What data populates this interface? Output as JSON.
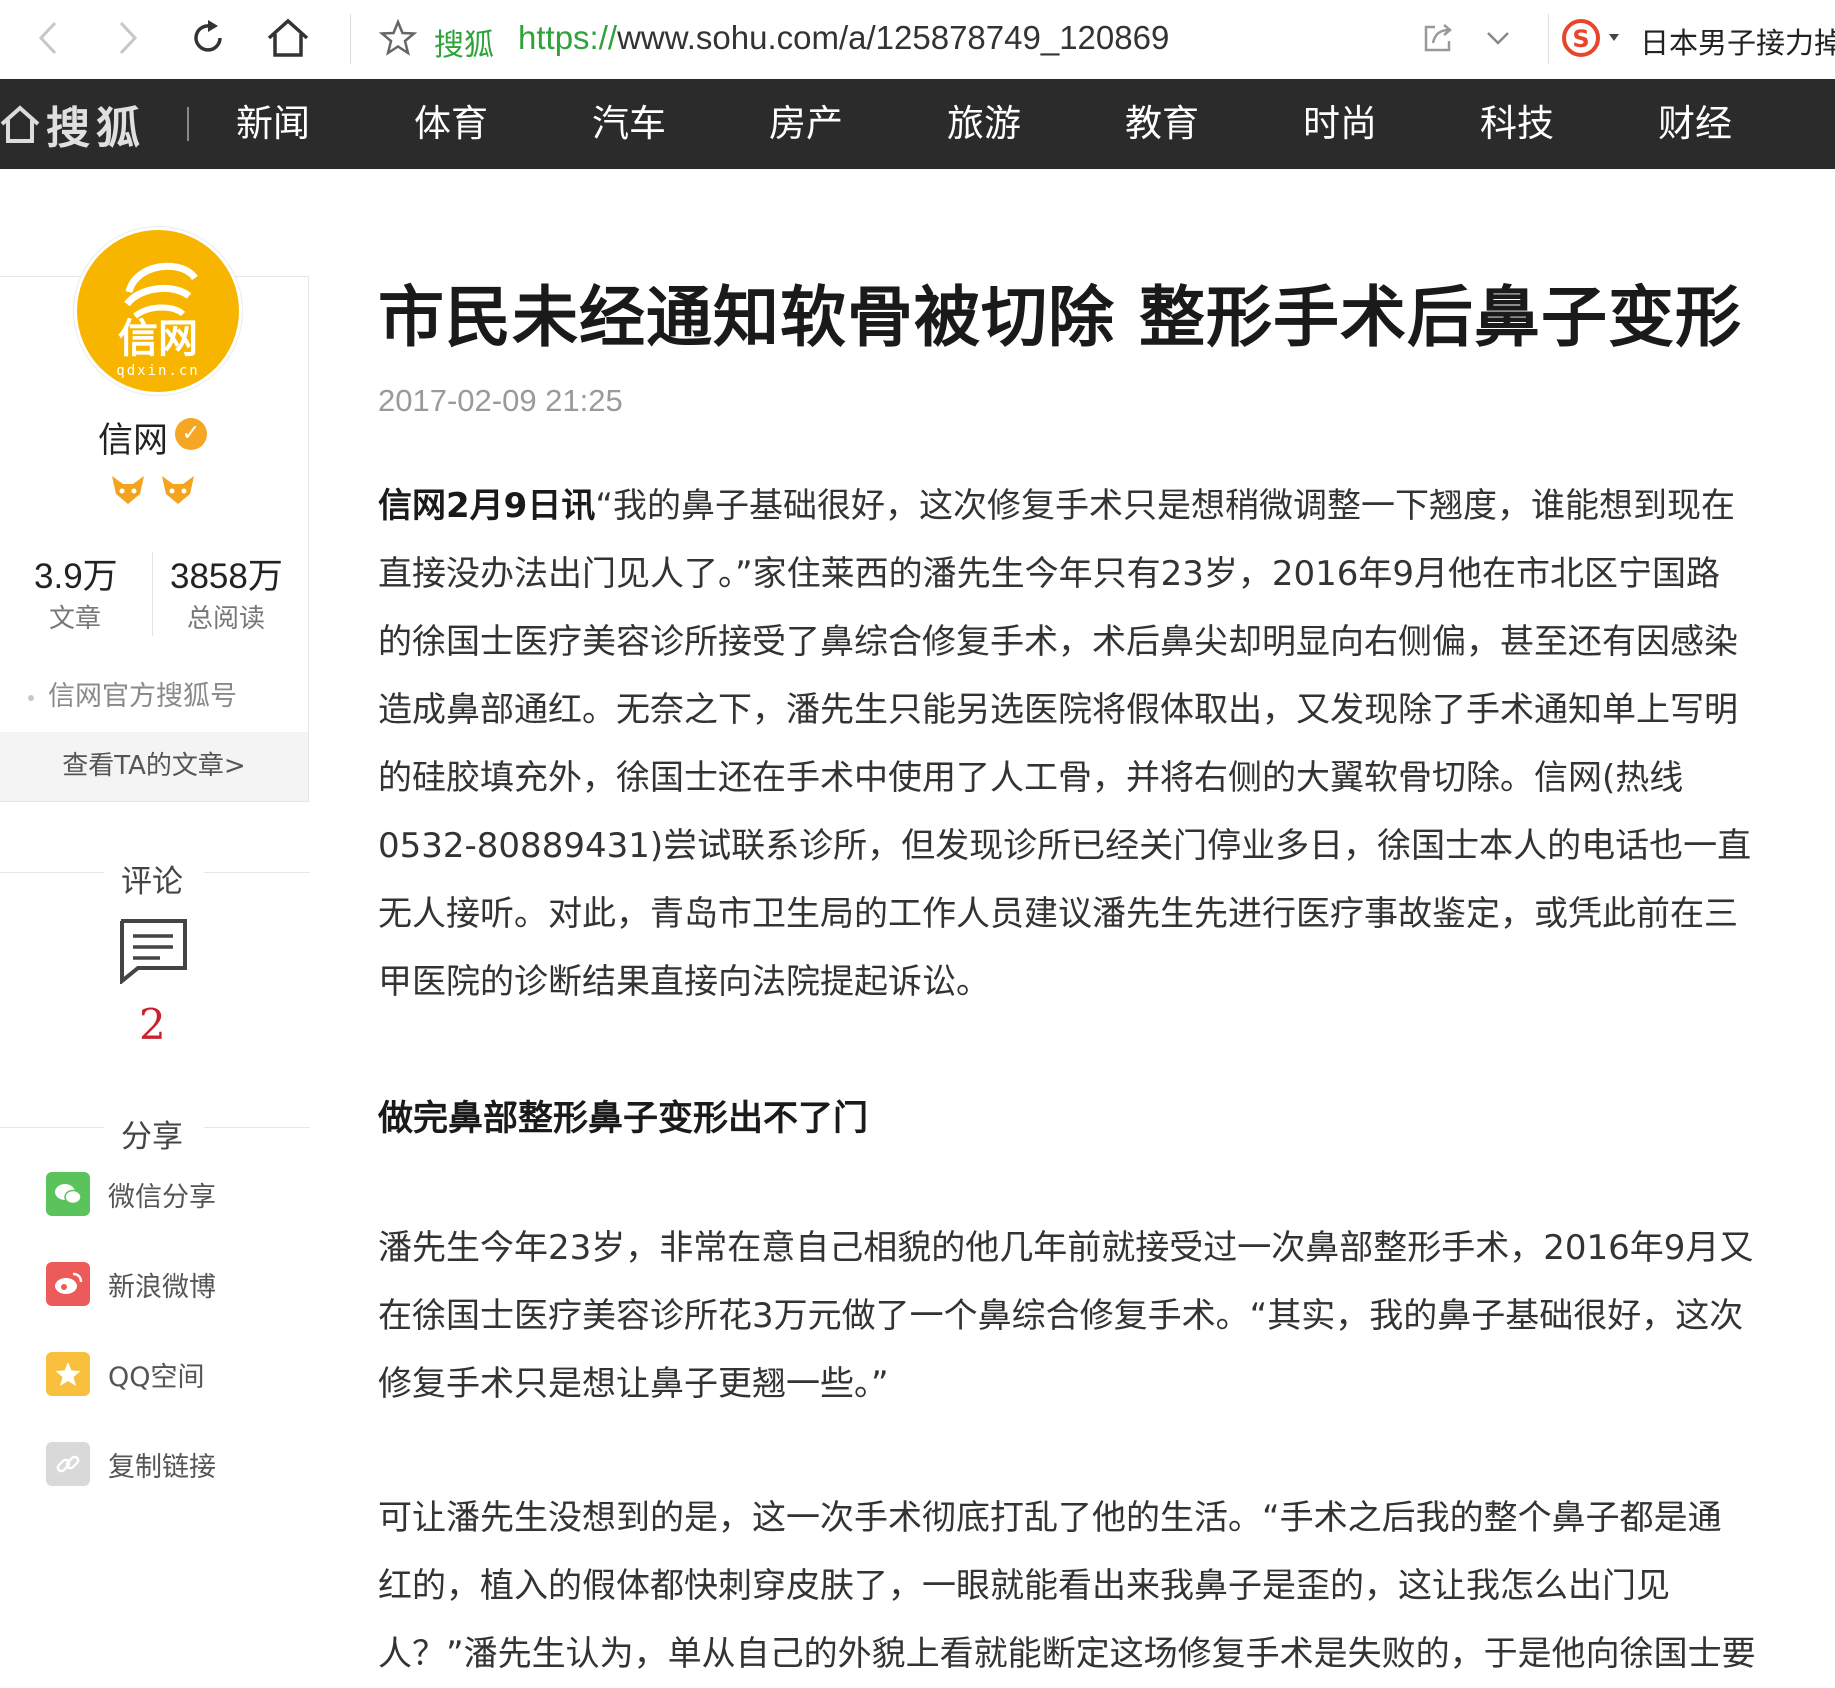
{
  "browser": {
    "site_name": "搜狐",
    "url_scheme": "https://",
    "url_rest": "www.sohu.com/a/125878749_120869",
    "search_text": "日本男子接力掉"
  },
  "site_nav": {
    "logo_text": "搜狐",
    "items": [
      "新闻",
      "体育",
      "汽车",
      "房产",
      "旅游",
      "教育",
      "时尚",
      "科技",
      "财经"
    ]
  },
  "author": {
    "avatar_text": "信网",
    "avatar_domain": "qdxin.cn",
    "name": "信网",
    "articles_count": "3.9万",
    "articles_label": "文章",
    "reads_count": "3858万",
    "reads_label": "总阅读",
    "description": "信网官方搜狐号",
    "view_articles": "查看TA的文章>"
  },
  "comments": {
    "heading": "评论",
    "count": "2"
  },
  "share": {
    "heading": "分享",
    "items": [
      "微信分享",
      "新浪微博",
      "QQ空间",
      "复制链接"
    ]
  },
  "article": {
    "title": "市民未经通知软骨被切除 整形手术后鼻子变形",
    "date": "2017-02-09 21:25",
    "p1_lead": "信网2月9日讯",
    "p1_lines": [
      "“我的鼻子基础很好，这次修复手术只是想稍微调整一下翘度，谁能想到现在",
      "直接没办法出门见人了。”家住莱西的潘先生今年只有23岁，2016年9月他在市北区宁国路",
      "的徐国士医疗美容诊所接受了鼻综合修复手术，术后鼻尖却明显向右侧偏，甚至还有因感染",
      "造成鼻部通红。无奈之下，潘先生只能另选医院将假体取出，又发现除了手术通知单上写明",
      "的硅胶填充外，徐国士还在手术中使用了人工骨，并将右侧的大翼软骨切除。信网(热线",
      "0532-80889431)尝试联系诊所，但发现诊所已经关门停业多日，徐国士本人的电话也一直",
      "无人接听。对此，青岛市卫生局的工作人员建议潘先生先进行医疗事故鉴定，或凭此前在三",
      "甲医院的诊断结果直接向法院提起诉讼。"
    ],
    "subheading": "做完鼻部整形鼻子变形出不了门",
    "p2_lines": [
      "潘先生今年23岁，非常在意自己相貌的他几年前就接受过一次鼻部整形手术，2016年9月又",
      "在徐国士医疗美容诊所花3万元做了一个鼻综合修复手术。“其实，我的鼻子基础很好，这次",
      "修复手术只是想让鼻子更翘一些。”"
    ],
    "p3_lines": [
      "可让潘先生没想到的是，这一次手术彻底打乱了他的生活。“手术之后我的整个鼻子都是通",
      "红的，植入的假体都快刺穿皮肤了，一眼就能看出来我鼻子是歪的，这让我怎么出门见",
      "人？”潘先生认为，单从自己的外貌上看就能断定这场修复手术是失败的，于是他向徐国士要"
    ]
  },
  "colors": {
    "nav_bg": "#2b2b2b",
    "brand_green": "#2fa33a",
    "comment_red": "#c8222c",
    "avatar_yellow": "#f7b500"
  }
}
